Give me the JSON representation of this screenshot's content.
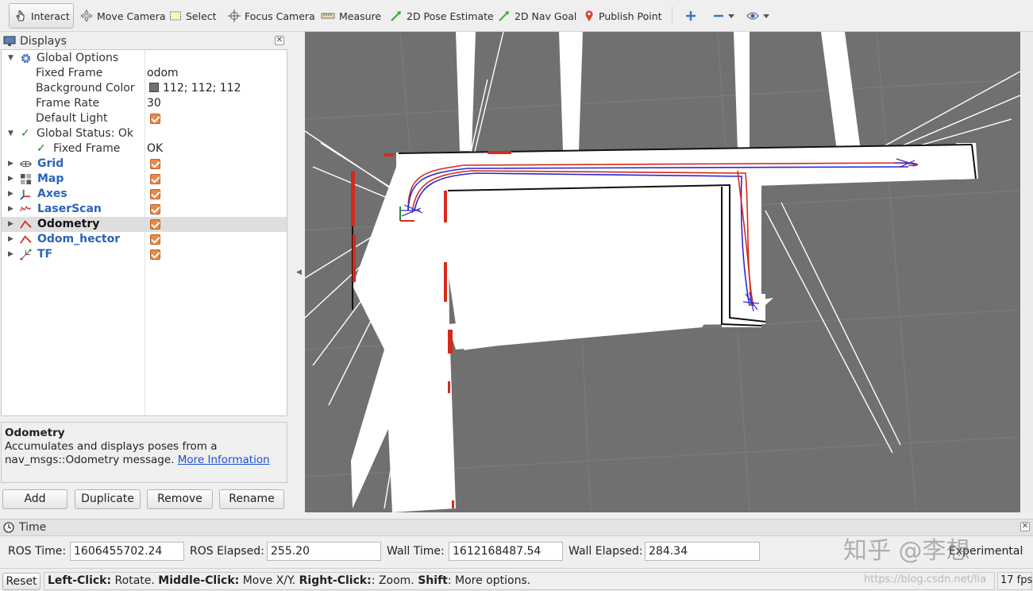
{
  "toolbar": {
    "tools": [
      {
        "label": "Interact",
        "icon": "hand-cursor-icon",
        "active": true
      },
      {
        "label": "Move Camera",
        "icon": "move-camera-icon"
      },
      {
        "label": "Select",
        "icon": "select-rect-icon"
      },
      {
        "label": "Focus Camera",
        "icon": "focus-camera-icon"
      },
      {
        "label": "Measure",
        "icon": "ruler-icon"
      },
      {
        "label": "2D Pose Estimate",
        "icon": "pose-arrow-icon"
      },
      {
        "label": "2D Nav Goal",
        "icon": "nav-arrow-icon"
      },
      {
        "label": "Publish Point",
        "icon": "map-pin-icon"
      }
    ]
  },
  "displays": {
    "title": "Displays",
    "global_options": {
      "label": "Global Options",
      "fixed_frame": {
        "label": "Fixed Frame",
        "value": "odom"
      },
      "background_color": {
        "label": "Background Color",
        "value": "112; 112; 112",
        "color": "#707070"
      },
      "frame_rate": {
        "label": "Frame Rate",
        "value": "30"
      },
      "default_light": {
        "label": "Default Light",
        "checked": true
      }
    },
    "global_status": {
      "label": "Global Status: Ok",
      "fixed_frame": {
        "label": "Fixed Frame",
        "value": "OK"
      }
    },
    "items": [
      {
        "name": "Grid",
        "icon": "grid-icon",
        "checked": true
      },
      {
        "name": "Map",
        "icon": "map-icon",
        "checked": true
      },
      {
        "name": "Axes",
        "icon": "axes-icon",
        "checked": true
      },
      {
        "name": "LaserScan",
        "icon": "laserscan-icon",
        "checked": true
      },
      {
        "name": "Odometry",
        "icon": "odometry-icon",
        "checked": true,
        "selected": true
      },
      {
        "name": "Odom_hector",
        "icon": "odometry-icon",
        "checked": true
      },
      {
        "name": "TF",
        "icon": "tf-icon",
        "checked": true
      }
    ]
  },
  "description": {
    "title": "Odometry",
    "text": "Accumulates and displays poses from a nav_msgs::Odometry message.",
    "link": "More Information"
  },
  "buttons": {
    "add": "Add",
    "duplicate": "Duplicate",
    "remove": "Remove",
    "rename": "Rename"
  },
  "viewport": {
    "background": "#707070",
    "path_red": "#d62a1a",
    "path_blue": "#2a2ad0"
  },
  "time": {
    "title": "Time",
    "ros_time": {
      "label": "ROS Time:",
      "value": "1606455702.24"
    },
    "ros_elapsed": {
      "label": "ROS Elapsed:",
      "value": "255.20"
    },
    "wall_time": {
      "label": "Wall Time:",
      "value": "1612168487.54"
    },
    "wall_elapsed": {
      "label": "Wall Elapsed:",
      "value": "284.34"
    },
    "experimental": "Experimental"
  },
  "watermark": {
    "text": "知乎 @李想",
    "url": "https://blog.csdn.net/lia"
  },
  "status": {
    "reset": "Reset",
    "left_click": "Left-Click:",
    "left_click_action": " Rotate. ",
    "middle_click": "Middle-Click:",
    "middle_click_action": " Move X/Y. ",
    "right_click": "Right-Click:",
    "right_click_action": ": Zoom. ",
    "shift": "Shift",
    "shift_action": ": More options.",
    "fps": "17 fps"
  }
}
